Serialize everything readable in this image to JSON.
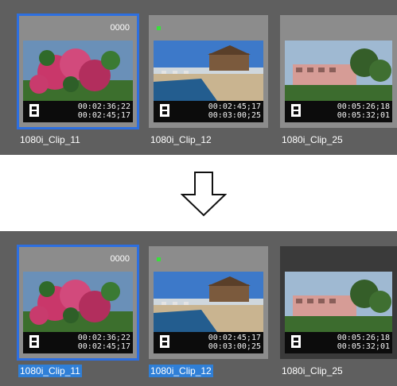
{
  "panels": [
    {
      "clips": [
        {
          "name": "1080i_Clip_11",
          "code": "0000",
          "tc_in": "00:02:36;22",
          "tc_out": "00:02:45;17",
          "selected": true,
          "name_highlight": false
        },
        {
          "name": "1080i_Clip_12",
          "code": "",
          "tc_in": "00:02:45;17",
          "tc_out": "00:03:00;25",
          "selected": false,
          "name_highlight": false
        },
        {
          "name": "1080i_Clip_25",
          "code": "",
          "tc_in": "00:05:26;18",
          "tc_out": "00:05:32;01",
          "selected": false,
          "name_highlight": false
        }
      ]
    },
    {
      "clips": [
        {
          "name": "1080i_Clip_11",
          "code": "0000",
          "tc_in": "00:02:36;22",
          "tc_out": "00:02:45;17",
          "selected": true,
          "name_highlight": true
        },
        {
          "name": "1080i_Clip_12",
          "code": "",
          "tc_in": "00:02:45;17",
          "tc_out": "00:03:00;25",
          "selected": false,
          "name_highlight": true
        },
        {
          "name": "1080i_Clip_25",
          "code": "",
          "tc_in": "00:05:26;18",
          "tc_out": "00:05:32;01",
          "selected": false,
          "name_highlight": false
        }
      ]
    }
  ],
  "icons": {
    "arrow": "down-arrow-icon",
    "film": "film-strip-icon",
    "flag": "green-flag-icon"
  },
  "colors": {
    "panel": "#5f5f5f",
    "selection": "#2d6fe0",
    "name_highlight": "#2f7fd7",
    "flag": "#38e03a"
  }
}
